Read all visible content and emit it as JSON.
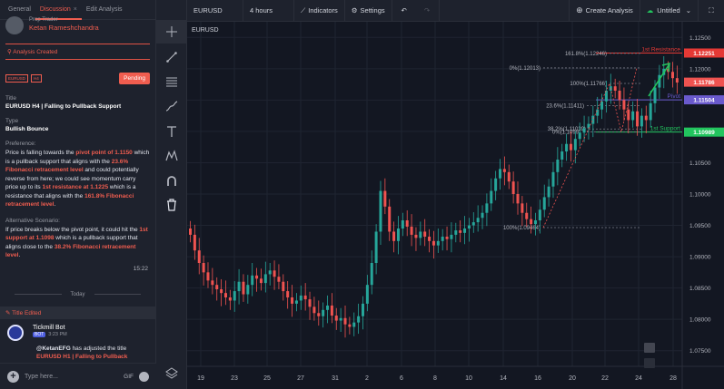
{
  "tabs": [
    {
      "label": "General"
    },
    {
      "label": "Discussion",
      "close": "×"
    },
    {
      "label": "Edit Analysis"
    }
  ],
  "post": {
    "author_role": "Prop Trader",
    "author_name": "Ketan Rameshchandra",
    "status_label": "Analysis Created",
    "tags": [
      "EURUSD",
      "H4"
    ],
    "status_button": "Pending",
    "title_label": "Title",
    "title": "EURUSD H4 | Falling to Pullback Support",
    "type_label": "Type",
    "type": "Bullish Bounce",
    "pref_label": "Preference:",
    "pref": [
      {
        "t": "Price is falling towards the "
      },
      {
        "t": "pivot point of 1.1150",
        "h": true
      },
      {
        "t": " which is a pullback support that aligns with the "
      },
      {
        "t": "23.6% Fibonacci retracement level",
        "h": true
      },
      {
        "t": " and could potentially reverse from here; we could see momentum carry price up to its "
      },
      {
        "t": "1st resistance at 1.1225",
        "h": true
      },
      {
        "t": " which is a resistance that aligns with the "
      },
      {
        "t": "161.8% Fibonacci retracement level",
        "h": true
      },
      {
        "t": "."
      }
    ],
    "alt_label": "Alternative Scenario:",
    "alt": [
      {
        "t": "If price breaks below the pivot point, it could hit the "
      },
      {
        "t": "1st support at 1.1098",
        "h": true
      },
      {
        "t": " which is a pullback support that aligns close to the "
      },
      {
        "t": "38.2% Fibonacci retracement level",
        "h": true
      },
      {
        "t": "."
      }
    ],
    "time": "15:22"
  },
  "divider_label": "Today",
  "edit_event": {
    "label": "Title Edited",
    "bot_name": "Tickmill Bot",
    "bot_badge": "BOT",
    "bot_time": "3:23 PM",
    "message": [
      {
        "t": "@KetanEFG",
        "b": true
      },
      {
        "t": "  has adjusted the title "
      },
      {
        "t": "EURUSD H1 | Falling to Pullback Support",
        "h": true
      },
      {
        "t": " to "
      },
      {
        "t": "EURUSD H4 | Falling to Pullback Support",
        "h": true
      }
    ]
  },
  "composer": {
    "placeholder": "Type here...",
    "gif": "GIF"
  },
  "toolbar": {
    "symbol": "EURUSD",
    "interval": "4 hours",
    "indicators": "Indicators",
    "settings": "Settings",
    "create": "Create Analysis",
    "layout": "Untitled"
  },
  "icons": {
    "tools": [
      "crosshair-icon",
      "trend-line-icon",
      "fib-retracement-icon",
      "brush-icon",
      "text-icon",
      "pattern-icon",
      "magnet-icon",
      "trash-icon",
      "layers-icon"
    ],
    "toolbar": [
      "chart-type-icon",
      "settings-icon",
      "undo-icon",
      "redo-icon",
      "plus-icon",
      "cloud-icon",
      "chevron-down-icon",
      "fullscreen-icon"
    ]
  },
  "colors": {
    "accent": "#f05d4f",
    "up": "#26a69a",
    "down": "#ef5350",
    "pivot": "#6a5acd",
    "support": "#22c55e",
    "resistance": "#e53935"
  },
  "chart_data": {
    "type": "candlestick",
    "symbol": "EURUSD",
    "x_ticks": [
      "19",
      "23",
      "25",
      "27",
      "31",
      "2",
      "6",
      "8",
      "10",
      "14",
      "16",
      "20",
      "22",
      "24",
      "28"
    ],
    "y_ticks": [
      1.125,
      1.12,
      1.115,
      1.11,
      1.105,
      1.1,
      1.095,
      1.09,
      1.085,
      1.08,
      1.075
    ],
    "ylim": [
      1.0725,
      1.1275
    ],
    "price_markers": [
      {
        "label": "1.12251",
        "value": 1.12251,
        "color": "#e53935"
      },
      {
        "label": "1.11786",
        "value": 1.11786,
        "color": "#ef5350"
      },
      {
        "label": "1.11504",
        "value": 1.11504,
        "color": "#6a5acd"
      },
      {
        "label": "1.10989",
        "value": 1.10989,
        "color": "#22c55e"
      }
    ],
    "levels": [
      {
        "name": "1st Resistance",
        "value": 1.12251,
        "color": "#e53935"
      },
      {
        "name": "Pivot",
        "value": 1.11504,
        "color": "#6a5acd"
      },
      {
        "name": "1st Support",
        "value": 1.10989,
        "color": "#22c55e"
      }
    ],
    "fib_levels": [
      {
        "label": "161.8%(1.12246)",
        "value": 1.12246
      },
      {
        "label": "0%(1.12013)",
        "value": 1.12013
      },
      {
        "label": "100%(1.11766)",
        "value": 1.11766
      },
      {
        "label": "23.6%(1.11411)",
        "value": 1.11411
      },
      {
        "label": "38.2%(1.11039)",
        "value": 1.11039
      },
      {
        "label": "0%(1.1099)",
        "value": 1.1099
      },
      {
        "label": "100%(1.09464)",
        "value": 1.09464
      }
    ],
    "close": [
      1.0935,
      1.091,
      1.089,
      1.0875,
      1.0862,
      1.0855,
      1.0848,
      1.0842,
      1.0835,
      1.083,
      1.0845,
      1.086,
      1.084,
      1.0855,
      1.087,
      1.0865,
      1.0858,
      1.0872,
      1.0878,
      1.0868,
      1.086,
      1.0845,
      1.0835,
      1.0825,
      1.083,
      1.0838,
      1.0832,
      1.082,
      1.081,
      1.0805,
      1.0815,
      1.0822,
      1.0806,
      1.0798,
      1.0802,
      1.0792,
      1.0788,
      1.0795,
      1.0805,
      1.0825,
      1.0855,
      1.089,
      1.094,
      1.1005,
      1.098,
      1.094,
      1.0925,
      1.0945,
      1.0958,
      1.0948,
      1.0935,
      1.093,
      1.094,
      1.0932,
      1.0925,
      1.0918,
      1.0925,
      1.0932,
      1.0928,
      1.0935,
      1.0942,
      1.0938,
      1.0945,
      1.095,
      1.0955,
      1.0962,
      1.097,
      1.0985,
      1.1005,
      1.1025,
      1.104,
      1.1035,
      1.102,
      1.1,
      1.0985,
      1.097,
      1.096,
      1.0952,
      1.0958,
      1.0975,
      1.0995,
      1.1012,
      1.1035,
      1.1055,
      1.1068,
      1.108,
      1.107,
      1.1088,
      1.1098,
      1.1105,
      1.1112,
      1.1125,
      1.1135,
      1.1148,
      1.1165,
      1.1172,
      1.1165,
      1.115,
      1.1135,
      1.1118,
      1.1132,
      1.1108,
      1.1125,
      1.1118,
      1.1145,
      1.117,
      1.119,
      1.12,
      1.1195,
      1.1185,
      1.1178
    ]
  }
}
